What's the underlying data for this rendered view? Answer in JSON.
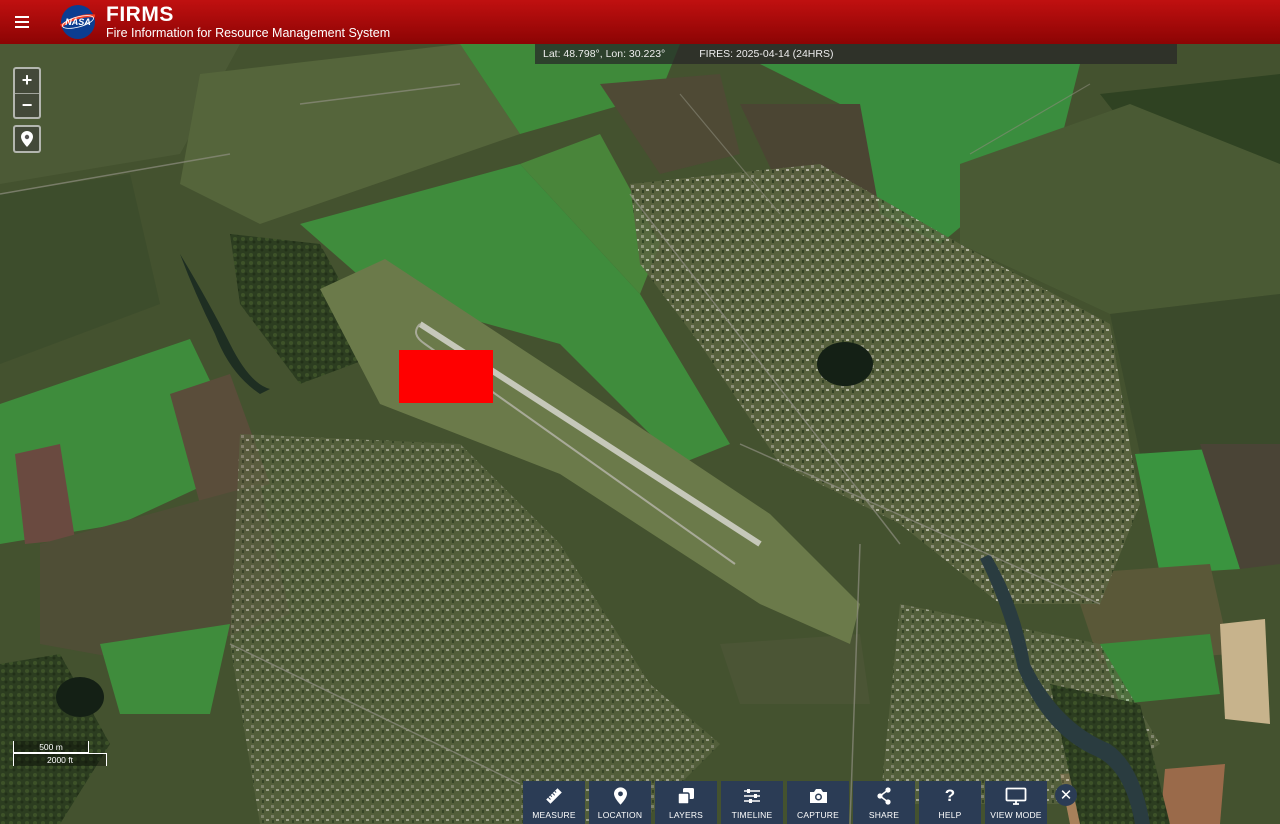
{
  "header": {
    "title": "FIRMS",
    "subtitle": "Fire Information for Resource Management System",
    "logo_text": "NASA",
    "color": "#b30c0c"
  },
  "status_bar": {
    "coordinates": "Lat: 48.798°, Lon: 30.223°",
    "fires": "FIRES: 2025-04-14 (24HRS)"
  },
  "map_controls": {
    "zoom_in": "+",
    "zoom_out": "−"
  },
  "scale_bar": {
    "metric": "500 m",
    "imperial": "2000 ft"
  },
  "fire_marker_color": "#ff0000",
  "toolbar": {
    "items": [
      {
        "label": "MEASURE",
        "icon": "ruler-icon"
      },
      {
        "label": "LOCATION",
        "icon": "pin-icon"
      },
      {
        "label": "LAYERS",
        "icon": "layers-icon"
      },
      {
        "label": "TIMELINE",
        "icon": "sliders-icon"
      },
      {
        "label": "CAPTURE",
        "icon": "camera-icon"
      },
      {
        "label": "SHARE",
        "icon": "share-icon"
      },
      {
        "label": "HELP",
        "icon": "help-icon"
      },
      {
        "label": "VIEW MODE",
        "icon": "monitor-icon"
      }
    ],
    "close_label": "✕"
  }
}
